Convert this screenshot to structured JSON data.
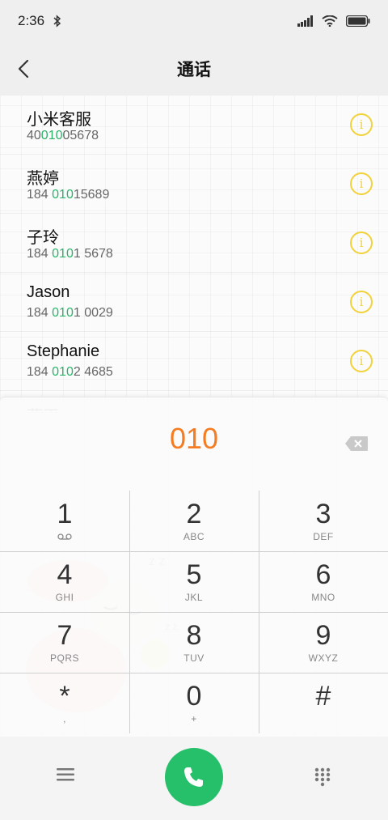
{
  "status": {
    "time": "2:36"
  },
  "header": {
    "title": "通话"
  },
  "contacts": [
    {
      "name": "小米客服",
      "number_pre": "40",
      "number_hl": "010",
      "number_post": "05678"
    },
    {
      "name": "燕婷",
      "number_pre": "184 ",
      "number_hl": "010",
      "number_post": "15689"
    },
    {
      "name": "子玲",
      "number_pre": "184 ",
      "number_hl": "010",
      "number_post": "1 5678"
    },
    {
      "name": "Jason",
      "number_pre": "184 ",
      "number_hl": "010",
      "number_post": "1 0029"
    },
    {
      "name": "Stephanie",
      "number_pre": "184 ",
      "number_hl": "010",
      "number_post": "2 4685"
    }
  ],
  "partial_contact": "燕正",
  "dial": {
    "input": "010"
  },
  "keys": [
    {
      "digit": "1",
      "letters": ""
    },
    {
      "digit": "2",
      "letters": "ABC"
    },
    {
      "digit": "3",
      "letters": "DEF"
    },
    {
      "digit": "4",
      "letters": "GHI"
    },
    {
      "digit": "5",
      "letters": "JKL"
    },
    {
      "digit": "6",
      "letters": "MNO"
    },
    {
      "digit": "7",
      "letters": "PQRS"
    },
    {
      "digit": "8",
      "letters": "TUV"
    },
    {
      "digit": "9",
      "letters": "WXYZ"
    },
    {
      "digit": "*",
      "letters": ","
    },
    {
      "digit": "0",
      "letters": "+"
    },
    {
      "digit": "#",
      "letters": ""
    }
  ],
  "icons": {
    "status": [
      "bluetooth-icon",
      "signal-icon",
      "wifi-icon",
      "battery-icon"
    ],
    "voicemail": "voicemail-icon",
    "back": "back-arrow-icon",
    "info": "info-icon",
    "backspace": "backspace-icon",
    "menu": "menu-icon",
    "call": "phone-icon",
    "keypad": "keypad-icon"
  },
  "colors": {
    "accent_orange": "#f47c22",
    "match_green": "#2bb36a",
    "info_yellow": "#f2d23b",
    "call_green": "#26bf6a"
  }
}
